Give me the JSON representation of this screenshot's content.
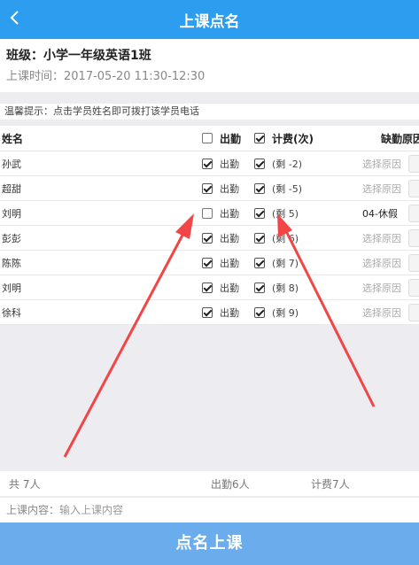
{
  "header": {
    "title": "上课点名"
  },
  "class_info": {
    "name": "班级：小学一年级英语1班",
    "time": "上课时间：2017-05-20 11:30-12:30"
  },
  "tip": "温馨提示：点击学员姓名即可拨打该学员电话",
  "table": {
    "headers": {
      "name": "姓名",
      "attendance": "出勤",
      "fee": "计费(次)",
      "reason": "缺勤原因"
    },
    "header_attendance_checked": false,
    "header_fee_checked": true,
    "rows": [
      {
        "name": "孙武",
        "attendance_label": "出勤",
        "attendance_checked": true,
        "fee_checked": true,
        "fee_text": "(剩 -2)",
        "reason": "选择原因",
        "reason_selected": false
      },
      {
        "name": "超甜",
        "attendance_label": "出勤",
        "attendance_checked": true,
        "fee_checked": true,
        "fee_text": "(剩 -5)",
        "reason": "选择原因",
        "reason_selected": false
      },
      {
        "name": "刘明",
        "attendance_label": "出勤",
        "attendance_checked": false,
        "fee_checked": true,
        "fee_text": "(剩 5)",
        "reason": "04-休假",
        "reason_selected": true
      },
      {
        "name": "彭彭",
        "attendance_label": "出勤",
        "attendance_checked": true,
        "fee_checked": true,
        "fee_text": "(剩 6)",
        "reason": "选择原因",
        "reason_selected": false
      },
      {
        "name": "陈陈",
        "attendance_label": "出勤",
        "attendance_checked": true,
        "fee_checked": true,
        "fee_text": "(剩 7)",
        "reason": "选择原因",
        "reason_selected": false
      },
      {
        "name": "刘明",
        "attendance_label": "出勤",
        "attendance_checked": true,
        "fee_checked": true,
        "fee_text": "(剩 8)",
        "reason": "选择原因",
        "reason_selected": false
      },
      {
        "name": "徐科",
        "attendance_label": "出勤",
        "attendance_checked": true,
        "fee_checked": true,
        "fee_text": "(剩 9)",
        "reason": "选择原因",
        "reason_selected": false
      }
    ]
  },
  "summary": {
    "total": "共 7人",
    "present": "出勤6人",
    "charged": "计费7人"
  },
  "lesson_content": {
    "label": "上课内容：",
    "placeholder": "输入上课内容"
  },
  "submit_label": "点名上课",
  "colors": {
    "header": "#2d9df0",
    "submit": "#6aacec",
    "arrow": "#f24545"
  }
}
